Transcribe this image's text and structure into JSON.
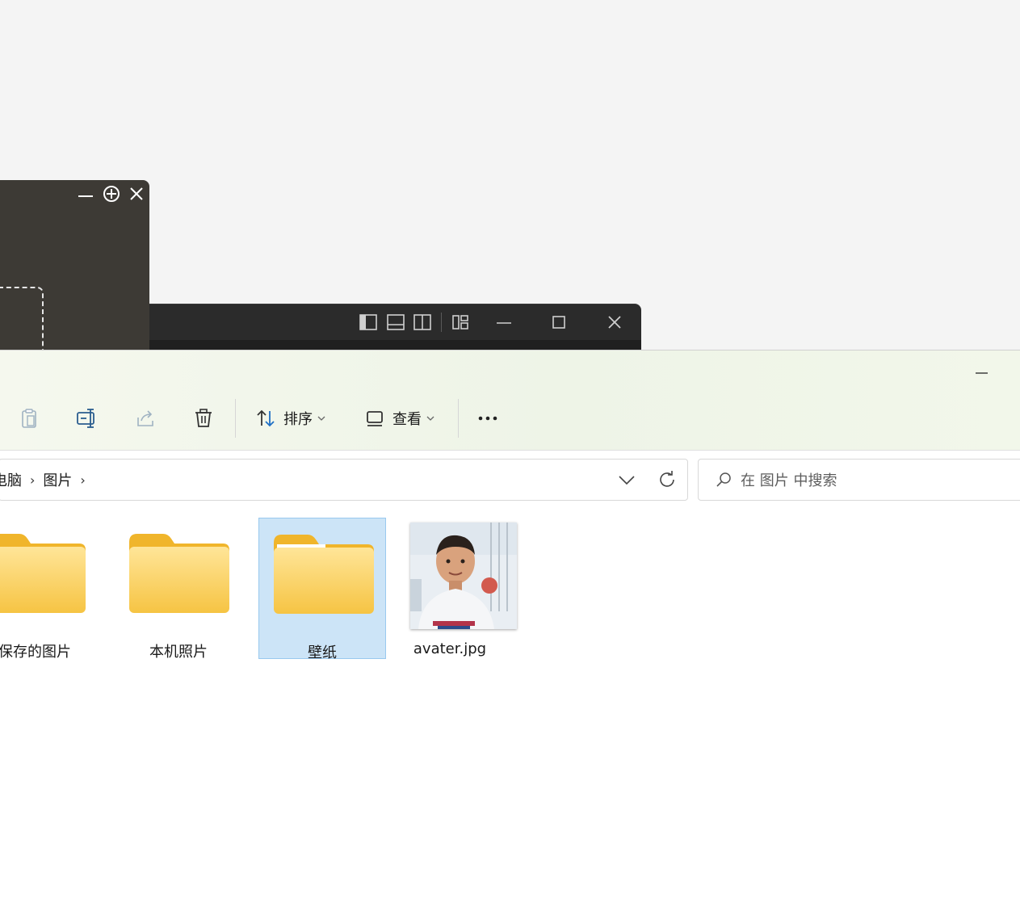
{
  "explorer": {
    "toolbar": {
      "sort_label": "排序",
      "view_label": "查看"
    },
    "breadcrumb": [
      "电脑",
      "图片"
    ],
    "search": {
      "placeholder": "在 图片 中搜索"
    },
    "items": [
      {
        "name": "保存的图片",
        "type": "folder"
      },
      {
        "name": "本机照片",
        "type": "folder"
      },
      {
        "name": "壁纸",
        "type": "folder",
        "selected": true
      },
      {
        "name": "avater.jpg",
        "type": "image"
      }
    ]
  },
  "colors": {
    "selection_bg": "#cce4f7",
    "folder_yellow": "#f9c840",
    "dark_window": "#3d3a35"
  }
}
